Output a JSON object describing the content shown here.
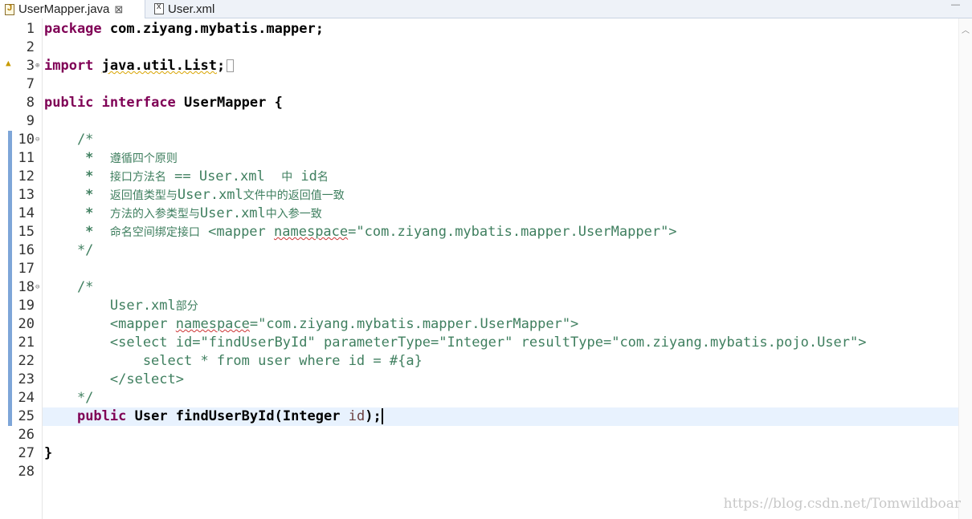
{
  "tabs": [
    {
      "label": "UserMapper.java",
      "active": true,
      "close": "⊠"
    },
    {
      "label": "User.xml",
      "active": false
    }
  ],
  "editor": {
    "line_numbers": [
      "1",
      "2",
      "3",
      "7",
      "8",
      "9",
      "10",
      "11",
      "12",
      "13",
      "14",
      "15",
      "16",
      "17",
      "18",
      "19",
      "20",
      "21",
      "22",
      "23",
      "24",
      "25",
      "26",
      "27",
      "28"
    ],
    "lines": {
      "l1": [
        "package",
        " com.ziyang.mybatis.mapper;"
      ],
      "l3": [
        "import",
        " ",
        "java.util.List",
        ";"
      ],
      "l8": [
        "public",
        " ",
        "interface",
        " UserMapper {"
      ],
      "l10": "    /*",
      "l11": [
        "     *  ",
        "遵循四个原则"
      ],
      "l12": [
        "     *  ",
        "接口方法名",
        " == User.xml  ",
        "中",
        " id",
        "名"
      ],
      "l13": [
        "     *  ",
        "返回值类型与",
        "User.xml",
        "文件中的返回值一致"
      ],
      "l14": [
        "     *  ",
        "方法的入参类型与",
        "User.xml",
        "中入参一致"
      ],
      "l15": [
        "     *  ",
        "命名空间绑定接口",
        " <mapper ",
        "namespace",
        "=\"com.ziyang.mybatis.mapper.UserMapper\">"
      ],
      "l16": "    */",
      "l18": "    /*",
      "l19": [
        "        User.xml",
        "部分"
      ],
      "l20": [
        "        <mapper ",
        "namespace",
        "=\"com.ziyang.mybatis.mapper.UserMapper\">"
      ],
      "l21": "        <select id=\"findUserById\" parameterType=\"Integer\" resultType=\"com.ziyang.mybatis.pojo.User\">",
      "l22": "            select * from user where id = #{a}",
      "l23": "        </select>",
      "l24": "    */",
      "l25": [
        "    ",
        "public",
        " User findUserById(Integer ",
        "id",
        ");"
      ],
      "l27": "}"
    }
  },
  "watermark": "https://blog.csdn.net/Tomwildboar",
  "colors": {
    "keyword": "#7f0055",
    "comment": "#3f7f5f",
    "current_line": "#e8f2fe",
    "change_bar": "#7ea6d8"
  }
}
